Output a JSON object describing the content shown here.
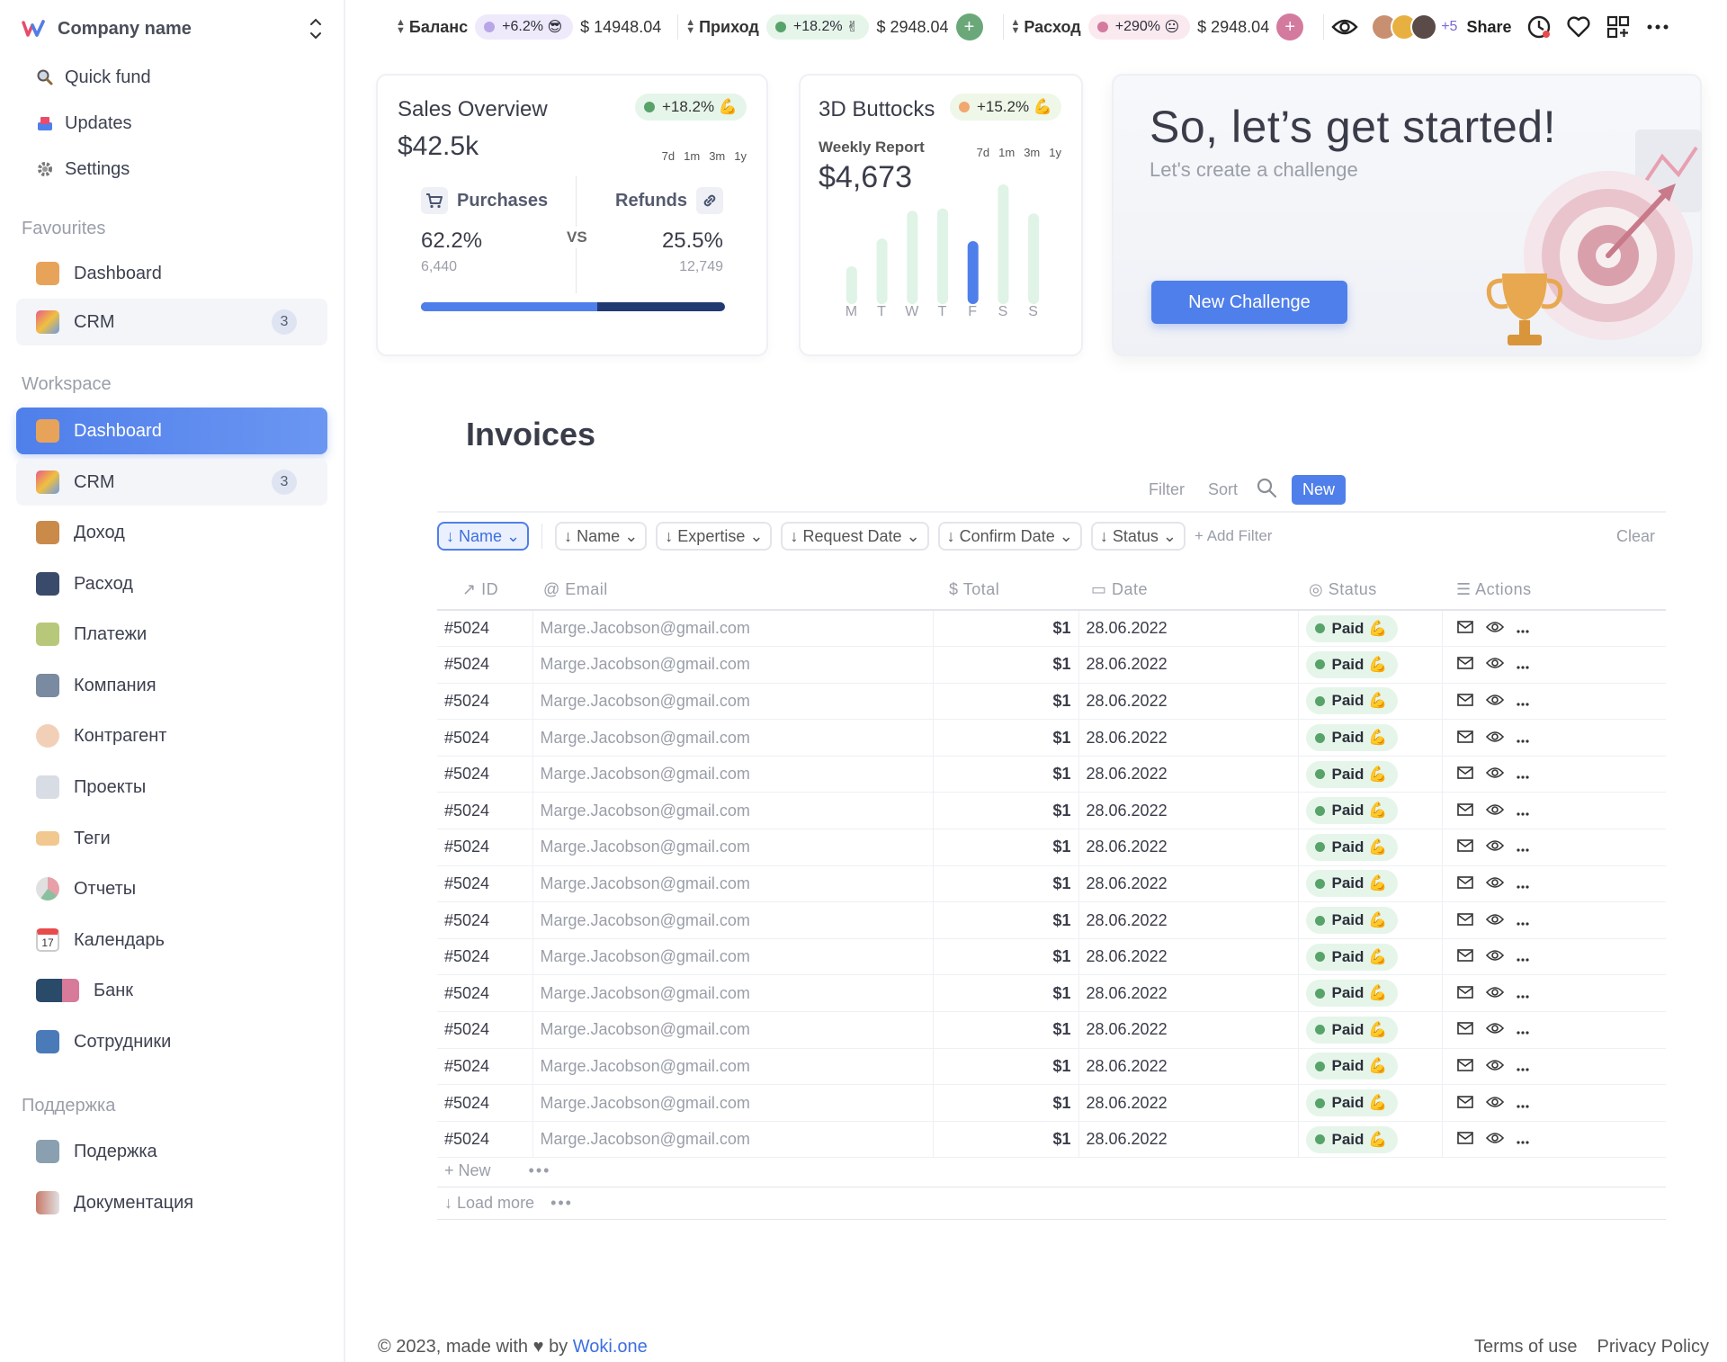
{
  "company": {
    "name": "Company name"
  },
  "sidebar": {
    "top_items": [
      {
        "label": "Quick fund",
        "icon": "search-icon"
      },
      {
        "label": "Updates",
        "icon": "updates-icon"
      },
      {
        "label": "Settings",
        "icon": "gear-icon"
      }
    ],
    "favourites_title": "Favourites",
    "favourites": [
      {
        "label": "Dashboard",
        "icon": "dashboard-icon"
      },
      {
        "label": "CRM",
        "icon": "crm-icon",
        "badge": "3"
      }
    ],
    "workspace_title": "Workspace",
    "workspace": [
      {
        "label": "Dashboard",
        "icon": "dashboard-icon"
      },
      {
        "label": "CRM",
        "icon": "crm-icon",
        "badge": "3"
      },
      {
        "label": "Доход",
        "icon": "income-icon"
      },
      {
        "label": "Расход",
        "icon": "expense-icon"
      },
      {
        "label": "Платежи",
        "icon": "payments-icon"
      },
      {
        "label": "Компания",
        "icon": "company-icon"
      },
      {
        "label": "Контрагент",
        "icon": "counterparty-icon"
      },
      {
        "label": "Проекты",
        "icon": "projects-icon"
      },
      {
        "label": "Теги",
        "icon": "tags-icon"
      },
      {
        "label": "Отчеты",
        "icon": "reports-icon"
      },
      {
        "label": "Календарь",
        "icon": "calendar-icon",
        "icon_text": "17"
      },
      {
        "label": "Банк",
        "icon": "bank-icon"
      },
      {
        "label": "Сотрудники",
        "icon": "employees-icon"
      }
    ],
    "support_title": "Поддержка",
    "support": [
      {
        "label": "Подержка",
        "icon": "support-icon"
      },
      {
        "label": "Документация",
        "icon": "docs-icon"
      }
    ]
  },
  "topbar": {
    "balance": {
      "label": "Баланс",
      "change": "+6.2%",
      "emoji": "😎",
      "amount": "$ 14948.04",
      "color": "#b9a6e8",
      "bg": "#efeafb"
    },
    "income": {
      "label": "Приход",
      "change": "+18.2%",
      "emoji": "✌",
      "amount": "$ 2948.04",
      "color": "#57a36a",
      "bg": "#e6f5ea",
      "button": "+"
    },
    "expense": {
      "label": "Расход",
      "change": "+290%",
      "emoji": "😐",
      "amount": "$ 2948.04",
      "color": "#d47a9e",
      "bg": "#fbe9f0",
      "button": "+"
    },
    "more_avatars": "+5",
    "share": "Share"
  },
  "sales_card": {
    "title": "Sales Overview",
    "change": "+18.2%",
    "emoji": "💪",
    "total": "$42.5k",
    "periods": [
      "7d",
      "1m",
      "3m",
      "1y"
    ],
    "purchases_label": "Purchases",
    "refunds_label": "Refunds",
    "vs": "VS",
    "purchases_pct": "62.2%",
    "purchases_count": "6,440",
    "refunds_pct": "25.5%",
    "refunds_count": "12,749",
    "progress": {
      "purchases": 0.58
    }
  },
  "weekly_card": {
    "title": "3D Buttocks",
    "change": "+15.2%",
    "emoji": "💪",
    "subtitle": "Weekly Report",
    "periods": [
      "7d",
      "1m",
      "3m",
      "1y"
    ],
    "amount": "$4,673",
    "days": [
      "M",
      "T",
      "W",
      "T",
      "F",
      "S",
      "S"
    ],
    "values": [
      0.3,
      0.52,
      0.74,
      0.76,
      0.5,
      0.95,
      0.72
    ],
    "highlight_index": 4
  },
  "challenge_card": {
    "title": "So, let’s get started!",
    "subtitle": "Let's create a challenge",
    "button": "New Challenge"
  },
  "invoices": {
    "title": "Invoices",
    "toolbar": {
      "filter": "Filter",
      "sort": "Sort",
      "new": "New"
    },
    "filters": [
      "Name",
      "Name",
      "Expertise",
      "Request Date",
      "Confirm Date",
      "Status"
    ],
    "add_filter": "Add Filter",
    "clear": "Clear",
    "columns": [
      "ID",
      "Email",
      "Total",
      "Date",
      "Status",
      "Actions"
    ],
    "rows": [
      {
        "id": "#5024",
        "email": "Marge.Jacobson@gmail.com",
        "total": "$1",
        "date": "28.06.2022",
        "status": "Paid"
      },
      {
        "id": "#5024",
        "email": "Marge.Jacobson@gmail.com",
        "total": "$1",
        "date": "28.06.2022",
        "status": "Paid"
      },
      {
        "id": "#5024",
        "email": "Marge.Jacobson@gmail.com",
        "total": "$1",
        "date": "28.06.2022",
        "status": "Paid"
      },
      {
        "id": "#5024",
        "email": "Marge.Jacobson@gmail.com",
        "total": "$1",
        "date": "28.06.2022",
        "status": "Paid"
      },
      {
        "id": "#5024",
        "email": "Marge.Jacobson@gmail.com",
        "total": "$1",
        "date": "28.06.2022",
        "status": "Paid"
      },
      {
        "id": "#5024",
        "email": "Marge.Jacobson@gmail.com",
        "total": "$1",
        "date": "28.06.2022",
        "status": "Paid"
      },
      {
        "id": "#5024",
        "email": "Marge.Jacobson@gmail.com",
        "total": "$1",
        "date": "28.06.2022",
        "status": "Paid"
      },
      {
        "id": "#5024",
        "email": "Marge.Jacobson@gmail.com",
        "total": "$1",
        "date": "28.06.2022",
        "status": "Paid"
      },
      {
        "id": "#5024",
        "email": "Marge.Jacobson@gmail.com",
        "total": "$1",
        "date": "28.06.2022",
        "status": "Paid"
      },
      {
        "id": "#5024",
        "email": "Marge.Jacobson@gmail.com",
        "total": "$1",
        "date": "28.06.2022",
        "status": "Paid"
      },
      {
        "id": "#5024",
        "email": "Marge.Jacobson@gmail.com",
        "total": "$1",
        "date": "28.06.2022",
        "status": "Paid"
      },
      {
        "id": "#5024",
        "email": "Marge.Jacobson@gmail.com",
        "total": "$1",
        "date": "28.06.2022",
        "status": "Paid"
      },
      {
        "id": "#5024",
        "email": "Marge.Jacobson@gmail.com",
        "total": "$1",
        "date": "28.06.2022",
        "status": "Paid"
      },
      {
        "id": "#5024",
        "email": "Marge.Jacobson@gmail.com",
        "total": "$1",
        "date": "28.06.2022",
        "status": "Paid"
      },
      {
        "id": "#5024",
        "email": "Marge.Jacobson@gmail.com",
        "total": "$1",
        "date": "28.06.2022",
        "status": "Paid"
      }
    ],
    "status_emoji": "💪",
    "new_row": "New",
    "load_more": "Load more"
  },
  "footer": {
    "copyright": "© 2023, made with",
    "by": "by",
    "brand": "Woki.one",
    "terms": "Terms of use",
    "privacy": "Privacy Policy"
  }
}
